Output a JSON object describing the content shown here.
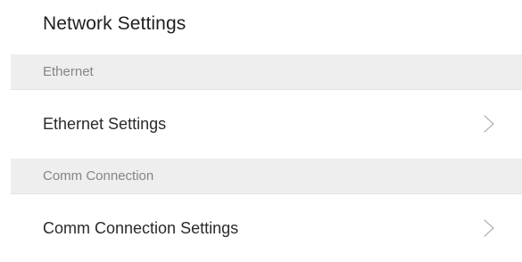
{
  "page": {
    "title": "Network Settings"
  },
  "sections": [
    {
      "header": "Ethernet",
      "item": {
        "label": "Ethernet Settings",
        "icon": "chevron-right-icon"
      }
    },
    {
      "header": "Comm Connection",
      "item": {
        "label": "Comm Connection Settings",
        "icon": "chevron-right-icon"
      }
    }
  ],
  "colors": {
    "background": "#ffffff",
    "section_header_bg": "#eeeeee",
    "section_header_text": "#858585",
    "primary_text": "#2a2a2a",
    "chevron": "#b5b5b5"
  }
}
